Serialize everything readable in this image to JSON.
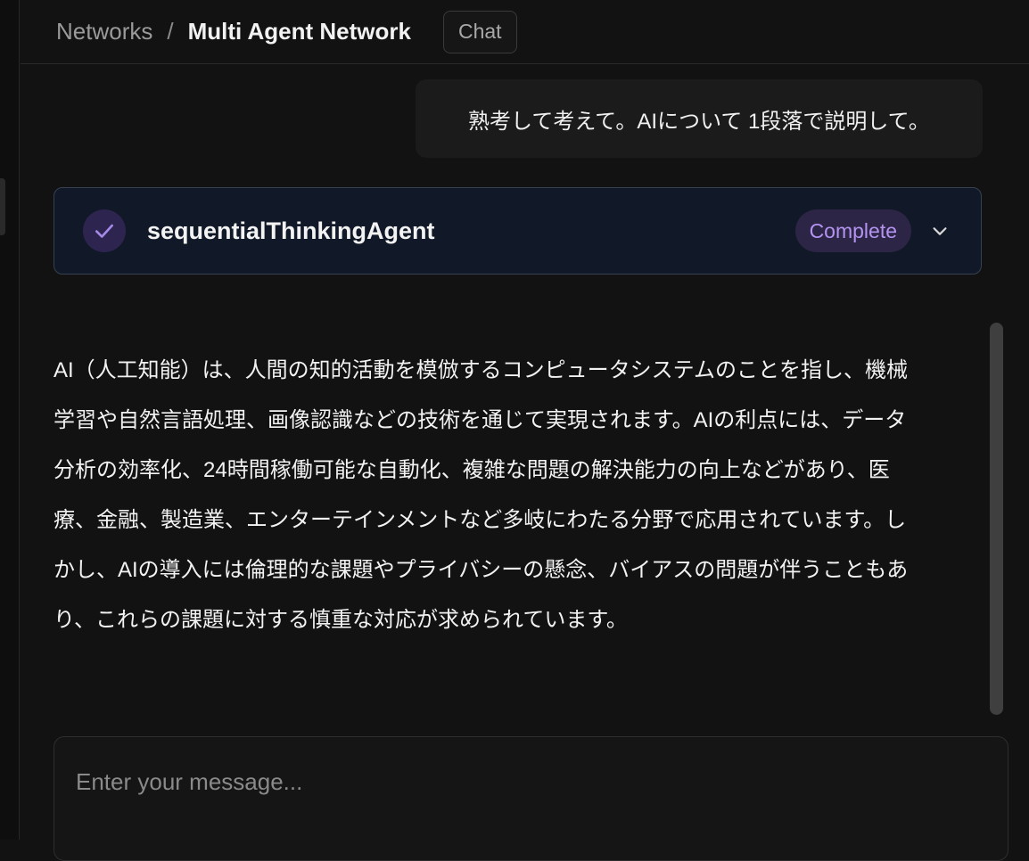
{
  "breadcrumb": {
    "parent": "Networks",
    "separator": "/",
    "current": "Multi Agent Network"
  },
  "header": {
    "tab_label": "Chat"
  },
  "user_message": "熟考して考えて。AIについて 1段落で説明して。",
  "agent_card": {
    "name": "sequentialThinkingAgent",
    "status": "Complete",
    "status_icon": "check-icon",
    "expand_icon": "chevron-down-icon",
    "accent_color": "#b394f0"
  },
  "response": {
    "text": "AI（人工知能）は、人間の知的活動を模倣するコンピュータシステムのことを指し、機械\n学習や自然言語処理、画像認識などの技術を通じて実現されます。AIの利点には、データ\n分析の効率化、24時間稼働可能な自動化、複雑な問題の解決能力の向上などがあり、医\n療、金融、製造業、エンターテインメントなど多岐にわたる分野で応用されています。し\nかし、AIの導入には倫理的な課題やプライバシーの懸念、バイアスの問題が伴うこともあ\nり、これらの課題に対する慎重な対応が求められています。"
  },
  "composer": {
    "placeholder": "Enter your message..."
  }
}
